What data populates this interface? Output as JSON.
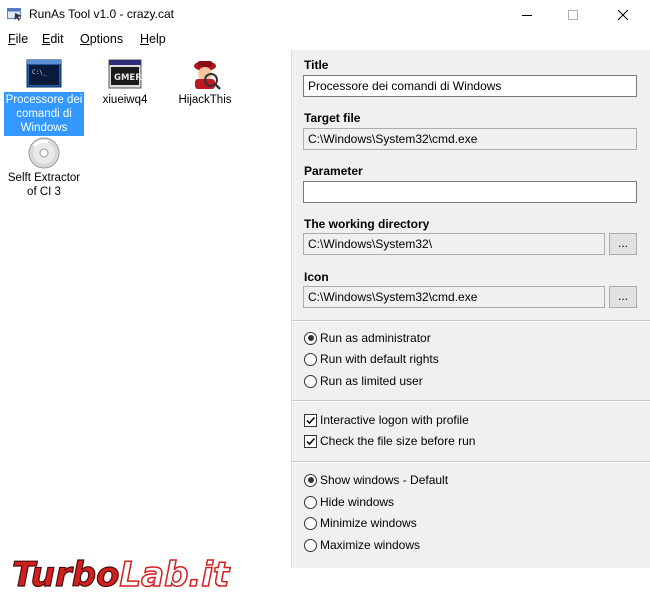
{
  "window": {
    "title": "RunAs Tool v1.0 - crazy.cat"
  },
  "menu": [
    {
      "label": "File",
      "accel": "F",
      "rest": "ile"
    },
    {
      "label": "Edit",
      "accel": "E",
      "rest": "dit"
    },
    {
      "label": "Options",
      "accel": "O",
      "rest": "ptions"
    },
    {
      "label": "Help",
      "accel": "H",
      "rest": "elp"
    }
  ],
  "icons": [
    {
      "label": "Processore dei comandi di Windows",
      "line1": "Processore dei",
      "line2": "comandi di",
      "line3": "Windows",
      "icon": "cmd-icon",
      "selected": true
    },
    {
      "label": "xiueiwq4",
      "line1": "xiueiwq4",
      "icon": "gmer-icon",
      "badge": "GMER"
    },
    {
      "label": "HijackThis",
      "line1": "HijackThis",
      "icon": "hijackthis-icon"
    },
    {
      "label": "Selft Extractor of CI 3",
      "line1": "Selft Extractor",
      "line2": "of CI 3",
      "icon": "cd-icon"
    }
  ],
  "form": {
    "title_label": "Title",
    "title_value": "Processore dei comandi di Windows",
    "target_label": "Target file",
    "target_value": "C:\\Windows\\System32\\cmd.exe",
    "parameter_label": "Parameter",
    "parameter_value": "",
    "workdir_label": "The working directory",
    "workdir_value": "C:\\Windows\\System32\\",
    "icon_label": "Icon",
    "icon_value": "C:\\Windows\\System32\\cmd.exe",
    "browse_label": "...",
    "rights": [
      {
        "label": "Run as administrator",
        "checked": true
      },
      {
        "label": "Run with default rights",
        "checked": false
      },
      {
        "label": "Run as limited user",
        "checked": false
      }
    ],
    "checks": [
      {
        "label": "Interactive logon with profile",
        "checked": true
      },
      {
        "label": "Check the file size before run",
        "checked": true
      }
    ],
    "window_modes": [
      {
        "label": "Show windows - Default",
        "checked": true
      },
      {
        "label": "Hide windows",
        "checked": false
      },
      {
        "label": "Minimize windows",
        "checked": false
      },
      {
        "label": "Maximize windows",
        "checked": false
      }
    ]
  },
  "watermark": {
    "text": "TurboLab.it",
    "part1": "Turbo",
    "part2": "Lab.it"
  },
  "colors": {
    "selection": "#3399ff",
    "form_bg": "#f0f0f0",
    "watermark_red": "#d21f1f"
  }
}
